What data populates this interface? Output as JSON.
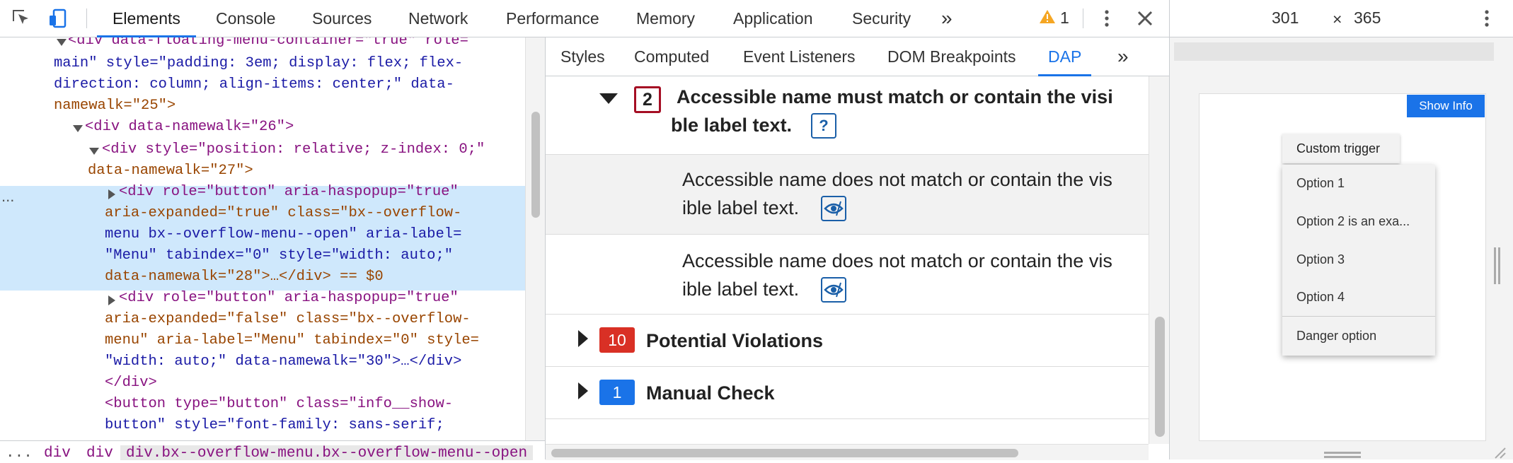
{
  "toolbar": {
    "tabs": [
      "Elements",
      "Console",
      "Sources",
      "Network",
      "Performance",
      "Memory",
      "Application",
      "Security"
    ],
    "more": "»",
    "warning_count": "1"
  },
  "elements": {
    "l1": {
      "tag_open": "<div ",
      "a1": "data-floating-menu-container",
      "v1": "\"true\"",
      "a2": " role=",
      "tail": ""
    },
    "lines": [
      "main\" style=\"padding: 3em; display: flex; flex-",
      "direction: column; align-items: center;\" data-",
      "namewalk=\"25\">",
      "<div data-namewalk=\"26\">",
      "<div style=\"position: relative; z-index: 0;\"",
      "data-namewalk=\"27\">",
      "<div role=\"button\" aria-haspopup=\"true\"",
      "aria-expanded=\"true\" class=\"bx--overflow-",
      "menu bx--overflow-menu--open\" aria-label=",
      "\"Menu\" tabindex=\"0\" style=\"width: auto;\"",
      "data-namewalk=\"28\">…</div> == $0",
      "<div role=\"button\" aria-haspopup=\"true\"",
      "aria-expanded=\"false\" class=\"bx--overflow-",
      "menu\" aria-label=\"Menu\" tabindex=\"0\" style=",
      "\"width: auto;\" data-namewalk=\"30\">…</div>",
      "</div>",
      "<button type=\"button\" class=\"info__show-",
      "button\" style=\"font-family: sans-serif;"
    ],
    "first_line": "<div data-floating-menu-container=\"true\" role=",
    "ellipsis": "..."
  },
  "breadcrumbs": [
    "...",
    "div",
    "div",
    "div.bx--overflow-menu.bx--overflow-menu--open"
  ],
  "sidebar": {
    "tabs": [
      "Styles",
      "Computed",
      "Event Listeners",
      "DOM Breakpoints",
      "DAP"
    ],
    "more": "»"
  },
  "dap": {
    "rule": {
      "count": "2",
      "title_line1": "Accessible name must match or contain the visi",
      "title_line2": "ble label text.",
      "help": "?"
    },
    "issues": [
      {
        "line1": "Accessible name does not match or contain the vis",
        "line2": "ible label text."
      },
      {
        "line1": "Accessible name does not match or contain the vis",
        "line2": "ible label text."
      }
    ],
    "potential": {
      "count": "10",
      "label": "Potential Violations"
    },
    "manual": {
      "count": "1",
      "label": "Manual Check"
    }
  },
  "device": {
    "width": "301",
    "times": "×",
    "height": "365",
    "show_info": "Show Info",
    "trigger": "Custom trigger",
    "options": [
      "Option 1",
      "Option 2 is an exa...",
      "Option 3",
      "Option 4"
    ],
    "danger": "Danger option"
  },
  "colors": {
    "accent": "#1a73e8",
    "violation": "#d93025",
    "manual": "#1a73e8",
    "rule_border": "#a50e24",
    "show_info": "#1a73e8"
  }
}
